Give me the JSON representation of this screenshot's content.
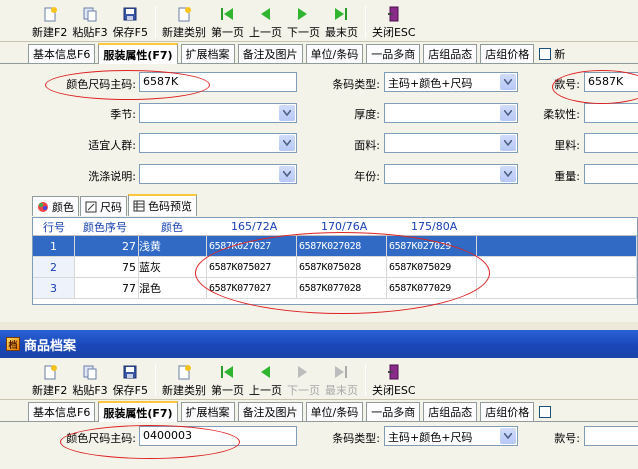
{
  "toolbar": {
    "buttons": [
      {
        "label": "新建F2"
      },
      {
        "label": "粘贴F3"
      },
      {
        "label": "保存F5"
      },
      {
        "label": "新建类别"
      },
      {
        "label": "第一页"
      },
      {
        "label": "上一页"
      },
      {
        "label": "下一页"
      },
      {
        "label": "最末页"
      },
      {
        "label": "关闭ESC"
      }
    ]
  },
  "tabs": [
    "基本信息F6",
    "服装属性(F7)",
    "扩展档案",
    "备注及图片",
    "单位/条码",
    "一品多商",
    "店组品态",
    "店组价格",
    "新"
  ],
  "form": {
    "color_size_code_label": "颜色尺码主码:",
    "color_size_code_value": "6587K",
    "barcode_type_label": "条码类型:",
    "barcode_type_value": "主码+颜色+尺码",
    "style_no_label": "款号:",
    "style_no_value": "6587K",
    "season_label": "季节:",
    "thickness_label": "厚度:",
    "softness_label": "柔软性:",
    "crowd_label": "适宜人群:",
    "fabric_label": "面料:",
    "lining_label": "里料:",
    "wash_label": "洗涤说明:",
    "year_label": "年份:",
    "weight_label": "重量:"
  },
  "subtabs": [
    "颜色",
    "尺码",
    "色码预览"
  ],
  "grid": {
    "headers": [
      "行号",
      "颜色序号",
      "颜色",
      "165/72A",
      "170/76A",
      "175/80A"
    ],
    "rows": [
      {
        "row": "1",
        "seq": "27",
        "color": "浅黄",
        "c1": "6587K027027",
        "c2": "6587K027028",
        "c3": "6587K027029"
      },
      {
        "row": "2",
        "seq": "75",
        "color": "蓝灰",
        "c1": "6587K075027",
        "c2": "6587K075028",
        "c3": "6587K075029"
      },
      {
        "row": "3",
        "seq": "77",
        "color": "混色",
        "c1": "6587K077027",
        "c2": "6587K077028",
        "c3": "6587K077029"
      }
    ]
  },
  "window2": {
    "title": "商品档案",
    "color_size_code_value": "0400003"
  }
}
